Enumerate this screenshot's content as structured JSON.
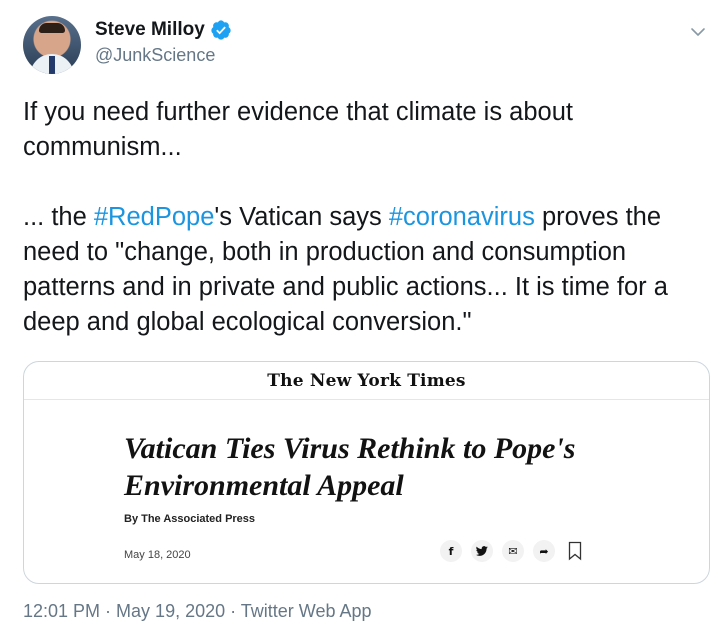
{
  "tweet": {
    "author": {
      "name": "Steve Milloy",
      "handle": "@JunkScience"
    },
    "text": {
      "line1": "If you need further evidence that climate is about communism...",
      "p2_start": "... the ",
      "hashtag1": "#RedPope",
      "p2_mid": "'s Vatican says ",
      "hashtag2": "#coronavirus",
      "p2_end": " proves the need to \"change, both in production and consumption patterns and in private and public actions... It is time for a deep and global ecological conversion.\""
    },
    "card": {
      "publisher": "The New York Times",
      "headline": "Vatican Ties Virus Rethink to Pope's Environmental Appeal",
      "byline": "By The Associated Press",
      "date": "May 18, 2020",
      "share_icons": [
        "facebook-icon",
        "twitter-icon",
        "email-icon",
        "share-arrow-icon",
        "bookmark-icon"
      ],
      "share_glyphs": {
        "facebook": "f",
        "twitter": "🐦",
        "email": "✉",
        "share": "➦"
      }
    },
    "meta": {
      "time": "12:01 PM",
      "sep1": " · ",
      "date": "May 19, 2020",
      "sep2": " · ",
      "app": "Twitter Web App"
    }
  },
  "colors": {
    "link": "#1b95e0",
    "secondary": "#657786",
    "verified": "#1da1f2",
    "border": "#ccd6dd"
  }
}
